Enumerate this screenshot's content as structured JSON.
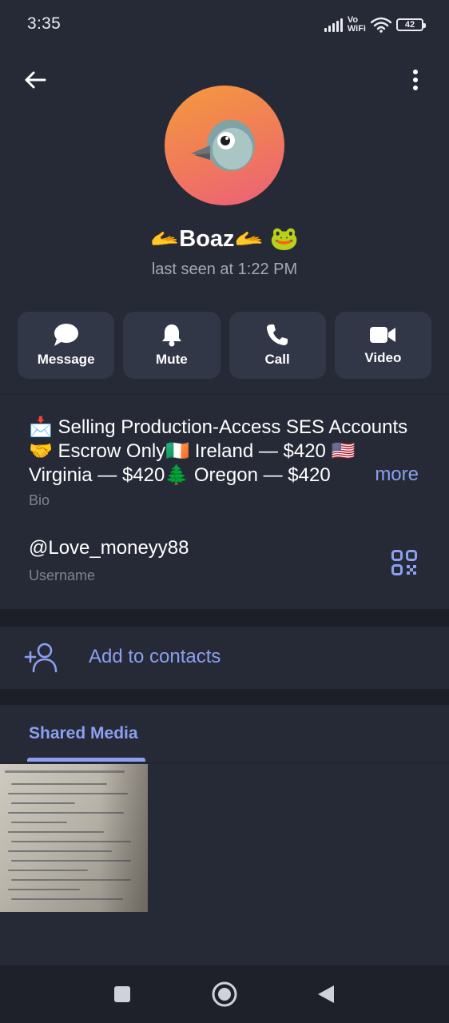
{
  "status_bar": {
    "time": "3:35",
    "network_top": "Vo",
    "network_bottom": "WiFi",
    "battery": "42"
  },
  "header": {
    "back_icon": "arrow-left-icon",
    "menu_icon": "vertical-dots-icon"
  },
  "profile": {
    "avatar_icon": "bird-emoji-icon",
    "name": "🫴Boaz🫴 🐸",
    "last_seen": "last seen at 1:22 PM"
  },
  "actions": [
    {
      "label": "Message",
      "icon": "chat-bubble-icon"
    },
    {
      "label": "Mute",
      "icon": "bell-icon"
    },
    {
      "label": "Call",
      "icon": "phone-icon"
    },
    {
      "label": "Video",
      "icon": "video-camera-icon"
    }
  ],
  "info": {
    "bio": "📩 Selling Production-Access SES Accounts🤝 Escrow Only🇮🇪 Ireland — $420 🇺🇸 Virginia — $420🌲 Oregon — $420",
    "bio_more": "more",
    "bio_caption": "Bio",
    "username": "@Love_moneyy88",
    "username_caption": "Username",
    "qr_icon": "qr-code-icon"
  },
  "add_contact": {
    "label": "Add to contacts",
    "icon": "add-user-icon"
  },
  "shared_media": {
    "tab_label": "Shared Media"
  },
  "colors": {
    "background": "#232733",
    "card": "#262a36",
    "accent": "#8c9ff0",
    "muted_text": "#7d8394"
  }
}
